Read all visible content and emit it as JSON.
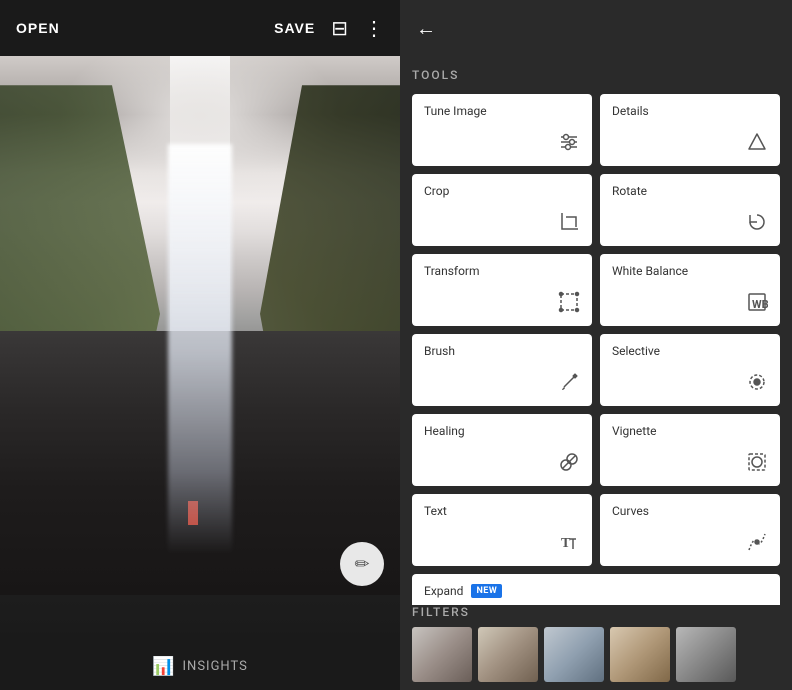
{
  "left_panel": {
    "header": {
      "open_label": "OPEN",
      "save_label": "SAVE"
    },
    "footer": {
      "insights_label": "INSIGHTS"
    }
  },
  "right_panel": {
    "tools_title": "TOOLS",
    "filters_title": "FILTERS",
    "tools": [
      {
        "id": "tune-image",
        "name": "Tune Image",
        "icon": "⊟",
        "icon_type": "sliders"
      },
      {
        "id": "details",
        "name": "Details",
        "icon": "▽",
        "icon_type": "triangle"
      },
      {
        "id": "crop",
        "name": "Crop",
        "icon": "⌐",
        "icon_type": "crop"
      },
      {
        "id": "rotate",
        "name": "Rotate",
        "icon": "↻",
        "icon_type": "rotate"
      },
      {
        "id": "transform",
        "name": "Transform",
        "icon": "⋯",
        "icon_type": "transform"
      },
      {
        "id": "white-balance",
        "name": "White Balance",
        "icon": "✦",
        "icon_type": "wb"
      },
      {
        "id": "brush",
        "name": "Brush",
        "icon": "✏",
        "icon_type": "brush"
      },
      {
        "id": "selective",
        "name": "Selective",
        "icon": "◎",
        "icon_type": "selective"
      },
      {
        "id": "healing",
        "name": "Healing",
        "icon": "✚",
        "icon_type": "healing"
      },
      {
        "id": "vignette",
        "name": "Vignette",
        "icon": "⬡",
        "icon_type": "vignette"
      },
      {
        "id": "text",
        "name": "Text",
        "icon": "T↕",
        "icon_type": "text"
      },
      {
        "id": "curves",
        "name": "Curves",
        "icon": "⌇",
        "icon_type": "curves"
      },
      {
        "id": "expand",
        "name": "Expand",
        "icon": "⊕",
        "icon_type": "expand",
        "badge": "NEW"
      }
    ]
  }
}
